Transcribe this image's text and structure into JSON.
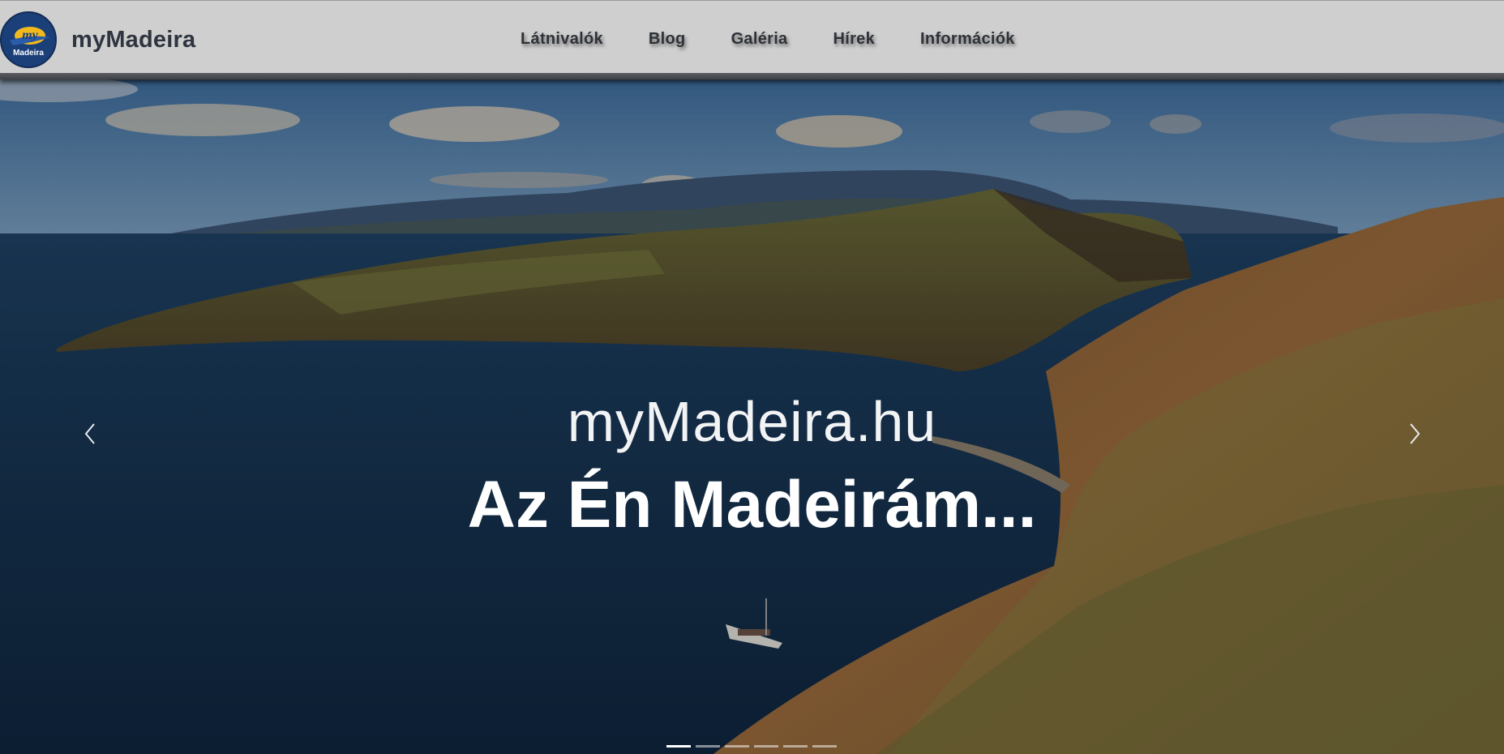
{
  "header": {
    "brand_name": "myMadeira",
    "logo": {
      "wordmark_top": "my",
      "wordmark_bottom": "Madeira"
    },
    "nav": [
      {
        "label": "Látnivalók"
      },
      {
        "label": "Blog"
      },
      {
        "label": "Galéria"
      },
      {
        "label": "Hírek"
      },
      {
        "label": "Információk"
      }
    ]
  },
  "hero": {
    "subtitle": "myMadeira.hu",
    "title": "Az Én Madeirám...",
    "slides_count": 6,
    "active_slide": 1,
    "prev_icon": "chevron-left-icon",
    "next_icon": "chevron-right-icon"
  },
  "colors": {
    "header_bg": "#cfcfcf",
    "header_text": "#2e3238",
    "logo_blue": "#1b3f78",
    "logo_yellow": "#f1b91e",
    "hero_text": "#ffffff"
  }
}
